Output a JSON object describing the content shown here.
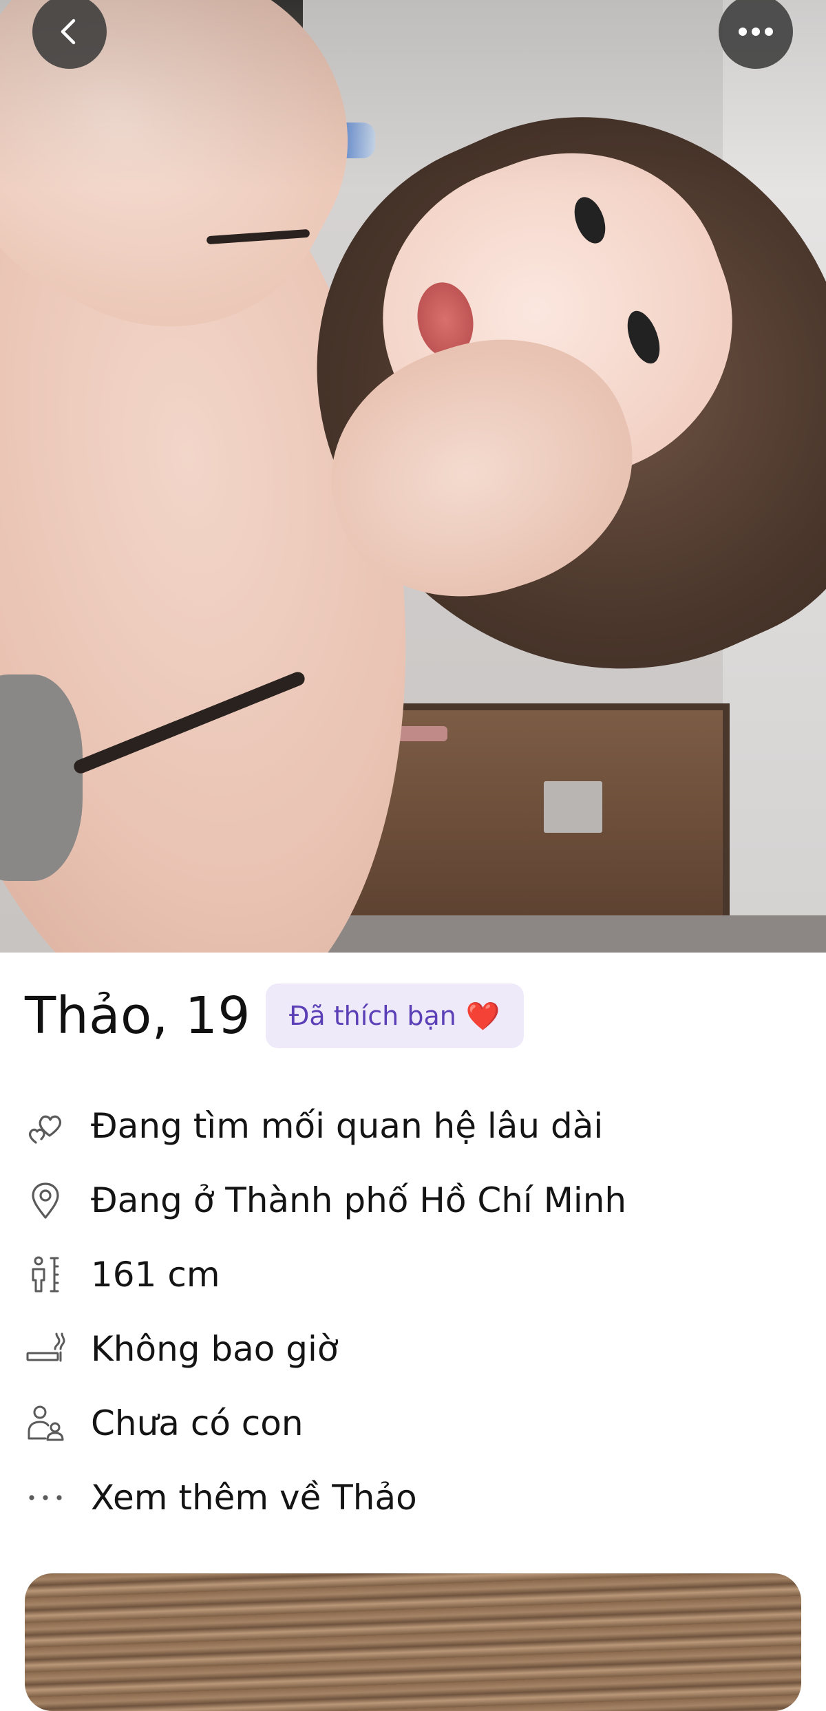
{
  "profile": {
    "name_age": "Thảo, 19",
    "liked_badge": "Đã thích bạn",
    "liked_badge_emoji": "❤️",
    "photo_alt": "profile-photo"
  },
  "actions": {
    "back_icon": "chevron-left-icon",
    "more_icon": "more-horizontal-icon"
  },
  "details": [
    {
      "icon": "hearts-icon",
      "text": "Đang tìm mối quan hệ lâu dài"
    },
    {
      "icon": "location-pin-icon",
      "text": "Đang ở Thành phố Hồ Chí Minh"
    },
    {
      "icon": "height-icon",
      "text": "161 cm"
    },
    {
      "icon": "smoking-icon",
      "text": "Không bao giờ"
    },
    {
      "icon": "children-icon",
      "text": "Chưa có con"
    },
    {
      "icon": "more-dots-icon",
      "text": "Xem thêm về Thảo"
    }
  ],
  "colors": {
    "badge_bg": "#efeaf9",
    "badge_text": "#5b3fb6",
    "icon_stroke": "#5a5a5a"
  }
}
